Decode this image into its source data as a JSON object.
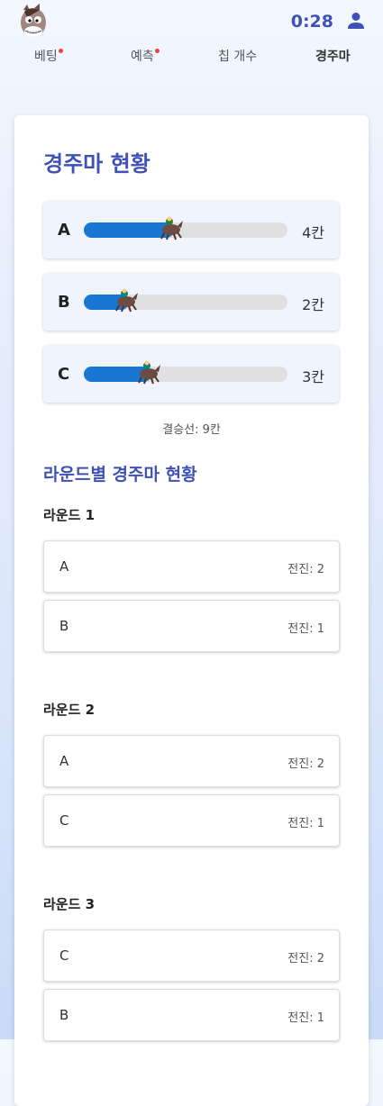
{
  "header": {
    "timer": "0:28",
    "logo_icon": "horse-mascot-icon",
    "user_icon": "user-icon"
  },
  "nav": {
    "tabs": [
      {
        "label": "베팅",
        "has_dot": true
      },
      {
        "label": "예측",
        "has_dot": true
      },
      {
        "label": "칩 개수",
        "has_dot": false
      },
      {
        "label": "경주마",
        "active": true
      }
    ]
  },
  "race": {
    "title": "경주마 현황",
    "horses": [
      {
        "name": "A",
        "steps": "4칸",
        "progress": 0.444
      },
      {
        "name": "B",
        "steps": "2칸",
        "progress": 0.222
      },
      {
        "name": "C",
        "steps": "3칸",
        "progress": 0.333
      }
    ],
    "finish_line": "결승선: 9칸"
  },
  "rounds": {
    "title": "라운드별 경주마 현황",
    "list": [
      {
        "title": "라운드 1",
        "items": [
          {
            "horse": "A",
            "advance": "전진: 2"
          },
          {
            "horse": "B",
            "advance": "전진: 1"
          }
        ]
      },
      {
        "title": "라운드 2",
        "items": [
          {
            "horse": "A",
            "advance": "전진: 2"
          },
          {
            "horse": "C",
            "advance": "전진: 1"
          }
        ]
      },
      {
        "title": "라운드 3",
        "items": [
          {
            "horse": "C",
            "advance": "전진: 2"
          },
          {
            "horse": "B",
            "advance": "전진: 1"
          }
        ]
      }
    ]
  },
  "colors": {
    "accent": "#3f51b5",
    "bar": "#1976d2",
    "dot": "#f44336"
  }
}
